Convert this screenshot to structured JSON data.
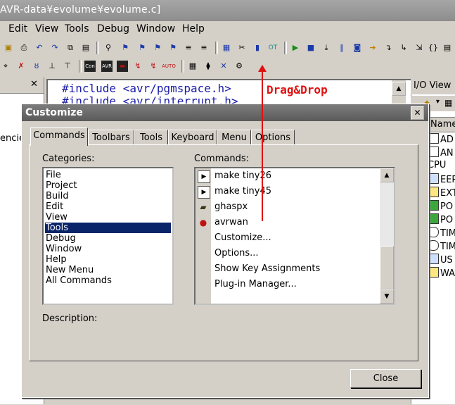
{
  "app": {
    "title": "AVR-data¥evolume¥evolume.c]"
  },
  "menubar": [
    {
      "label": "Edit"
    },
    {
      "label": "View"
    },
    {
      "label": "Tools"
    },
    {
      "label": "Debug"
    },
    {
      "label": "Window"
    },
    {
      "label": "Help"
    }
  ],
  "toolbar1_icons": [
    "new-icon",
    "print-icon",
    "undo-icon",
    "redo-icon",
    "copy-icon",
    "paste-icon",
    "find-icon",
    "bookmark-icon",
    "bookmark-next-icon",
    "bookmark-prev-icon",
    "bookmark-clear-icon",
    "indent-icon",
    "outdent-icon",
    "build-icon",
    "tools-icon",
    "chip-icon",
    "ot-icon",
    "run-icon",
    "stop-icon",
    "step-icon",
    "pause-icon",
    "reset-icon",
    "next-icon",
    "step-over-icon",
    "step-out-icon",
    "brace-icon",
    "io-icon"
  ],
  "left_pane": {
    "text": "encie"
  },
  "editor": {
    "lines": [
      "#include <avr/pgmspace.h>",
      "#include <avr/interrupt.h>"
    ]
  },
  "io_view": {
    "title": "I/O View",
    "column": "Name",
    "items": [
      "AD",
      "AN",
      "CPU",
      "EEP",
      "EXT",
      "PO",
      "PO",
      "TIM",
      "TIM",
      "US",
      "WA"
    ]
  },
  "dialog": {
    "title": "Customize",
    "tabs": [
      "Commands",
      "Toolbars",
      "Tools",
      "Keyboard",
      "Menu",
      "Options"
    ],
    "active_tab": "Commands",
    "categories_label": "Categories:",
    "categories": [
      "File",
      "Project",
      "Build",
      "Edit",
      "View",
      "Tools",
      "Debug",
      "Window",
      "Help",
      "New Menu",
      "All Commands"
    ],
    "selected_category": "Tools",
    "commands_label": "Commands:",
    "commands": [
      {
        "label": "make tiny26",
        "icon": "make-icon"
      },
      {
        "label": "make tiny45",
        "icon": "make-icon"
      },
      {
        "label": "ghaspx",
        "icon": "chip-icon"
      },
      {
        "label": "avrwan",
        "icon": "bug-icon"
      },
      {
        "label": "Customize...",
        "icon": ""
      },
      {
        "label": "Options...",
        "icon": ""
      },
      {
        "label": "Show Key Assignments",
        "icon": ""
      },
      {
        "label": "Plug-in Manager...",
        "icon": ""
      }
    ],
    "description_label": "Description:",
    "close_label": "Close"
  },
  "annotation": {
    "text": "Drag&Drop",
    "color": "#e01010"
  }
}
